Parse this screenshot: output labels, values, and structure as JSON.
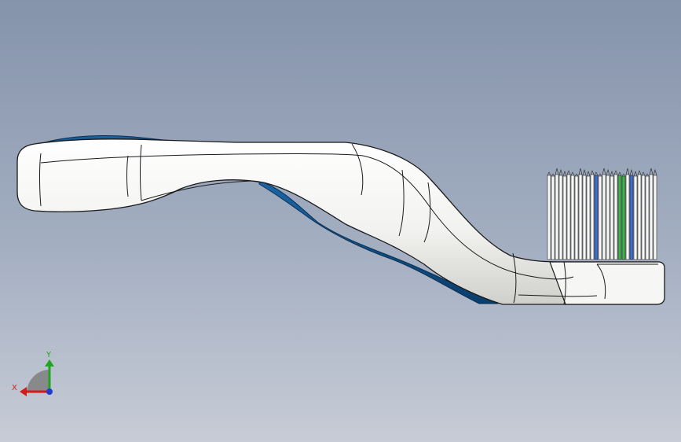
{
  "model": {
    "name": "",
    "colors": {
      "handle_body": "#f4f4f2",
      "grip_insert": "#0f4f86",
      "outline": "#1a1a1a",
      "bristle_white": "#f7f7f5",
      "bristle_blue": "#3b6fd1",
      "bristle_green": "#3fb34a"
    }
  },
  "triad": {
    "x_label": "X",
    "y_label": "Y",
    "colors": {
      "x": "#d11b1b",
      "y": "#1fa51f",
      "z": "#1f3ad1",
      "plane": "#7f7f7f"
    }
  }
}
